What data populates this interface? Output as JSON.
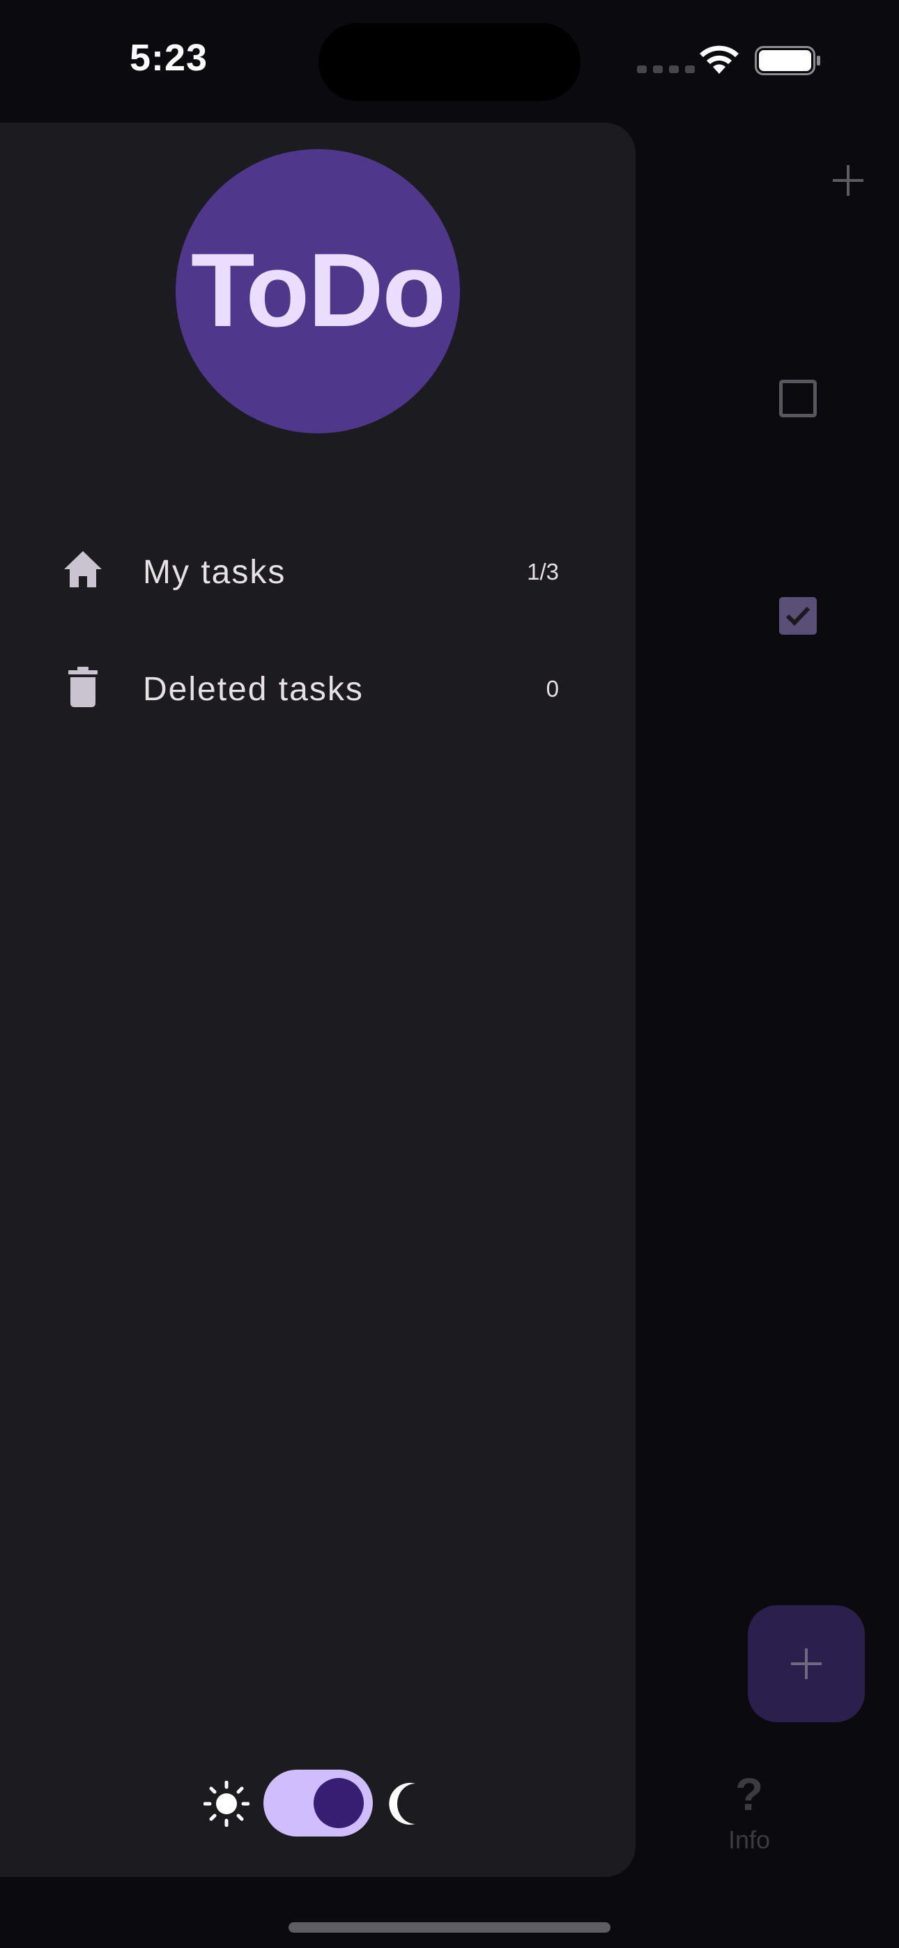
{
  "status_bar": {
    "time": "5:23",
    "wifi_icon": "wifi-icon",
    "battery_icon": "battery-full-icon"
  },
  "drawer": {
    "logo_text": "ToDo",
    "logo_color": "#4f378b",
    "items": [
      {
        "label": "My tasks",
        "count": "1/3",
        "icon": "home-icon"
      },
      {
        "label": "Deleted tasks",
        "count": "0",
        "icon": "trash-icon"
      }
    ],
    "theme_toggle": {
      "light_icon": "sun-icon",
      "dark_icon": "moon-icon",
      "dark_mode_on": true
    }
  },
  "background_app": {
    "add_icon": "plus-icon",
    "tasks": [
      {
        "checked": false
      },
      {
        "checked": true
      }
    ],
    "fab_icon": "plus-icon",
    "nav": {
      "info_glyph": "?",
      "info_label": "Info"
    }
  },
  "colors": {
    "background": "#0b0a0e",
    "drawer": "#1c1b20",
    "accent": "#cfbdfe",
    "accent_dark": "#381e72",
    "text": "#e6e1e5"
  }
}
